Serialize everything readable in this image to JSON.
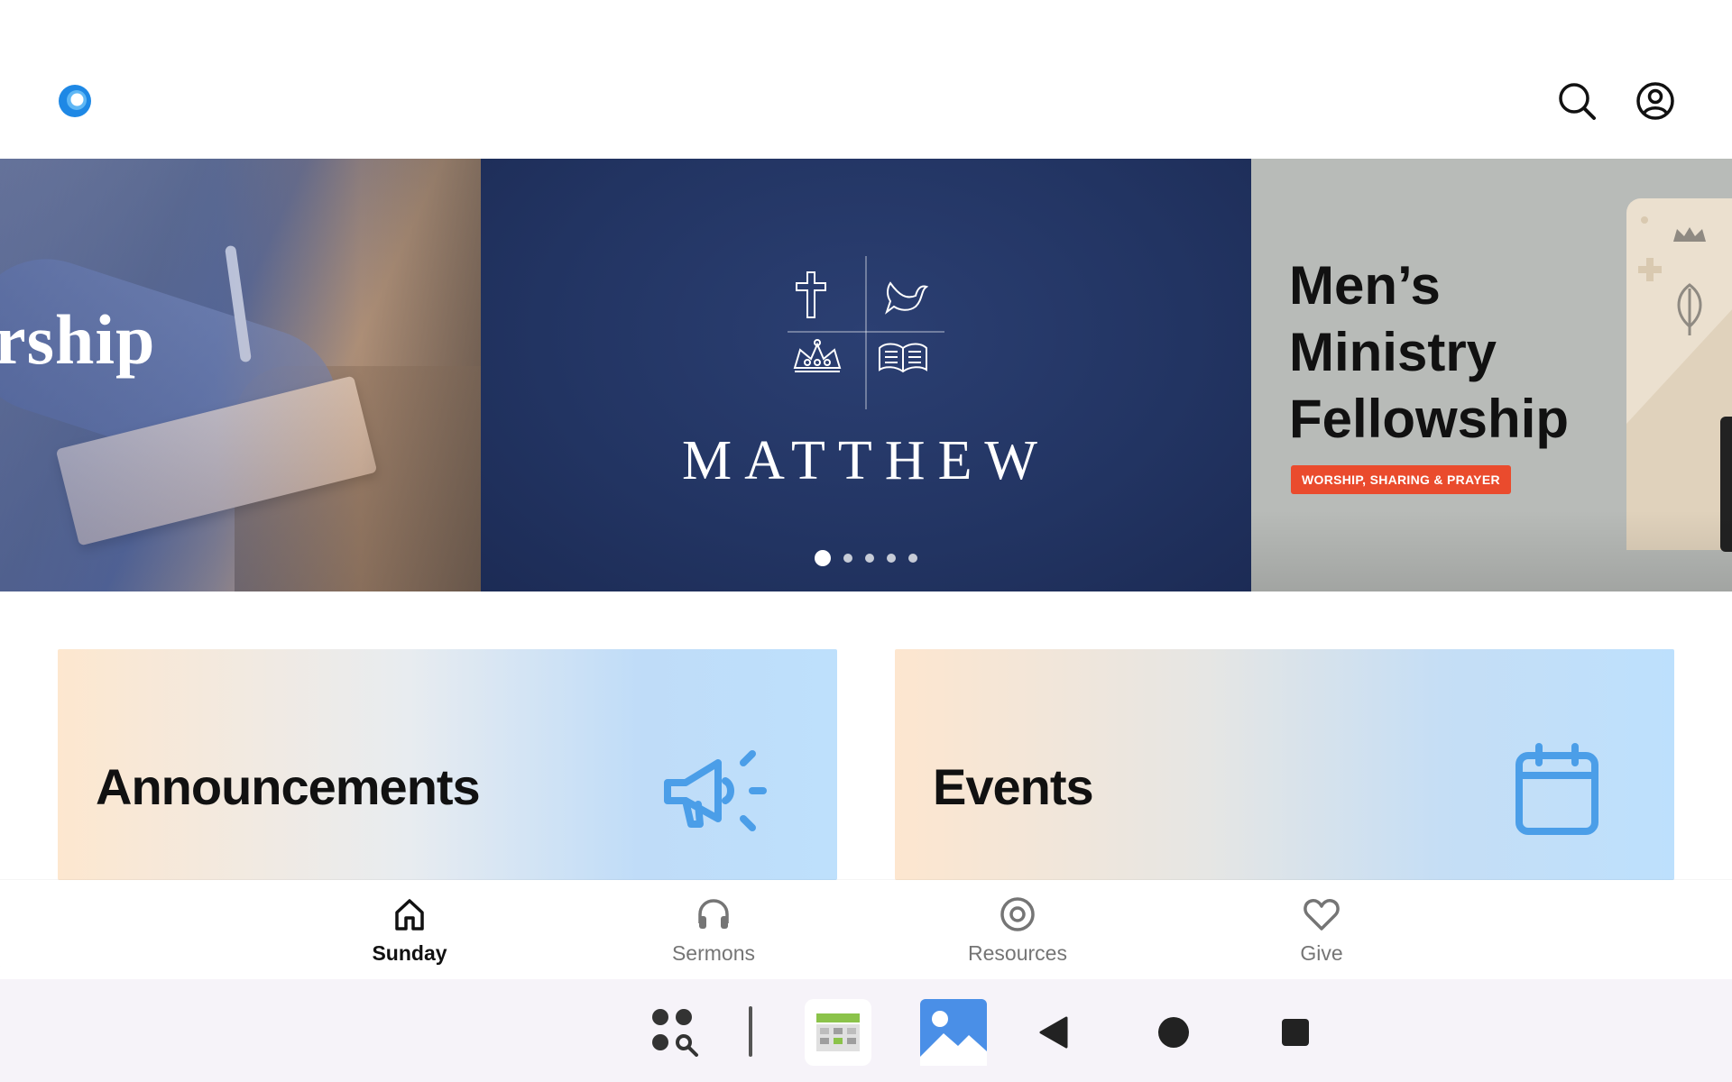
{
  "header": {
    "logo_icon": "church-app-logo",
    "search_icon": "search-icon",
    "account_icon": "account-circle-icon"
  },
  "carousel": {
    "slides": [
      {
        "title": "rship",
        "image": "worship-notebook-photo"
      },
      {
        "title": "MATTHEW",
        "emblem_icons": [
          "cross-icon",
          "dove-icon",
          "crown-icon",
          "open-bible-icon"
        ]
      },
      {
        "heading_lines": [
          "Men’s",
          "Ministry",
          "Fellowship"
        ],
        "tag": "WORSHIP, SHARING & PRAYER"
      }
    ],
    "page_count": 5,
    "active_index": 0
  },
  "tiles": {
    "announcements": {
      "label": "Announcements",
      "icon": "megaphone-icon"
    },
    "events": {
      "label": "Events",
      "icon": "calendar-icon"
    }
  },
  "bottom_nav": {
    "items": [
      {
        "label": "Sunday",
        "icon": "home-icon",
        "active": true
      },
      {
        "label": "Sermons",
        "icon": "headphones-icon",
        "active": false
      },
      {
        "label": "Resources",
        "icon": "target-icon",
        "active": false
      },
      {
        "label": "Give",
        "icon": "heart-icon",
        "active": false
      }
    ]
  },
  "system_bar": {
    "items": [
      "app-drawer-search-icon",
      "calendar-app-icon",
      "gallery-app-icon",
      "back-icon",
      "home-circle-icon",
      "recents-icon"
    ]
  },
  "colors": {
    "accent_blue": "#4b9ee8",
    "logo_blue": "#1e88e5",
    "tag_red": "#ea4b2d",
    "matthew_navy": "#223462"
  }
}
